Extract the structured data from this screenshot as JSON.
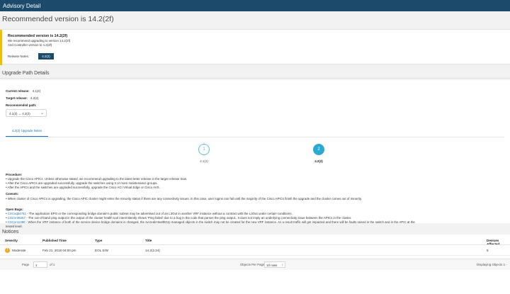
{
  "window": {
    "title": "Advisory Detail"
  },
  "page_title": "Recommended version is 14.2(2f)",
  "recommendation": {
    "heading": "Recommended version is 14.2(2f)",
    "line1": "We recommend upgrading to version 14.2(2f)",
    "line2": "And Controller version to 4.2(2f)",
    "release_notes_label": "Release Notes:",
    "release_notes_button": "4.2(2)"
  },
  "upgrade": {
    "section_title": "Upgrade Path Details",
    "current_label": "Current release:",
    "current_value": "4.1(2)",
    "target_label": "Target release:",
    "target_value": "4.2(2)",
    "path_label": "Recommended path:",
    "path_value": "4.1(2) → 4.2(2)",
    "tab_label": "4.2(2) Upgrade Notes",
    "steps": [
      {
        "number": "1",
        "label": "4.1(2)"
      },
      {
        "number": "2",
        "label": "4.2(2)"
      }
    ],
    "procedure_title": "Procedure:",
    "procedure": [
      "Upgrade the Cisco APICs. Unless otherwise stated, we recommend upgrading to the latest letter release in the target release train.",
      "After the Cisco APICs are upgraded successfully, upgrade the switches using 2 or more maintenance groups.",
      "After the APICs and the switches are upgraded successfully, upgrade the Cisco ACI Virtual Edge or Cisco AVS."
    ],
    "caveats_title": "Caveats:",
    "caveats": [
      "When cluster of Cisco APICs is upgrading, the Cisco APIC cluster might enter the minority status if there are any connectivity issues. In this case, user logins can fail until the majority of the Cisco APICs finish the upgrade and the cluster comes out of minority."
    ],
    "bugs_title": "Open Bugs:",
    "bugs": [
      {
        "id": "CSCvq54761",
        "text": " - The application EPG or the corresponding bridge domain's public subnet may be advertised out of an L3Out in another VRF instance without a contract with the L3Out under certain conditions."
      },
      {
        "id": "CSCvr38257",
        "text": " - The out-of-band ping output in the output of the cluster health tool intermittently shows 'Ping failed' due to a bug in the code that parses the ping output.. It does not imply an underlying connectivity issue between the APICs in the cluster."
      },
      {
        "id": "CSCvr11388",
        "text": " - When the VRF instance of both of the service device bridge domains is changed, the svcredirHealthGrp managed objects in the switch may not be created for the new VRF instance. As a result traffic will get impacted and there will be faults raised in the switch and in the APIC at the"
      }
    ],
    "bugs_wrap": "tenant level."
  },
  "notices": {
    "section_title": "Notices",
    "columns": [
      "Severity",
      "Published Time",
      "Type",
      "Title",
      "Devices Affected"
    ],
    "rows": [
      {
        "severity": "Moderate",
        "published": "Feb 21, 2018 04:00 pm",
        "type": "EOL S/W",
        "title": "14.2(2.24)",
        "devices": "5"
      }
    ]
  },
  "pagination": {
    "page_label": "Page",
    "page_value": "1",
    "of_label": "of 1",
    "per_page_label": "Objects Per Page",
    "per_page_value": "10 rows",
    "displaying": "Displaying Objects 1 -"
  },
  "colors": {
    "brand": "#1b4a6b",
    "accent": "#1b74b8",
    "warning": "#f0c000",
    "step": "#2aa9d2"
  }
}
